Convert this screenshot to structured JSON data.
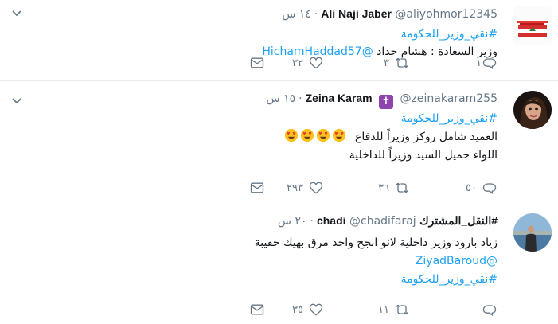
{
  "tweets": [
    {
      "name": "Ali Naji Jaber",
      "handle": "@aliyohmor12345",
      "time": "١٤ س",
      "line1_hashtag": "#نقي_وزير_للحكومة",
      "line2_text": "وزير السعادة : هشام حداد",
      "line2_mention": "@HichamHaddad57",
      "reply_count": "١",
      "retweet_count": "٣",
      "like_count": "٣٢"
    },
    {
      "name": "Zeina Karam",
      "badge": "✝",
      "handle": "@zeinakaram255",
      "time": "١٥ س",
      "line1_hashtag": "#نقي_وزير_للحكومة",
      "line2_text": "العميد شامل روكز وزيراً للدفاع",
      "line3_text": "اللواء جميل السيد وزيراً للداخلية",
      "reply_count": "٥٠",
      "retweet_count": "٣٦",
      "like_count": "٢٩٣"
    },
    {
      "name": "chadi",
      "name_hashtag": "#النقل_المشترك",
      "handle": "@chadifaraj",
      "time": "٢٠ س",
      "line1_text": "زياد بارود وزير داخلية لانو انجح واحد مرق بهيك حقيبة",
      "line2_mention": "@ZiyadBaroud",
      "line3_hashtag": "#نقي_وزير_للحكومة",
      "reply_count": "",
      "retweet_count": "١١",
      "like_count": "٣٥"
    }
  ],
  "colors": {
    "accent": "#1da1f2",
    "muted": "#657786",
    "divider": "#e6ecf0"
  },
  "icons": [
    "chevron-down-icon",
    "reply-icon",
    "retweet-icon",
    "like-icon",
    "mail-icon"
  ]
}
